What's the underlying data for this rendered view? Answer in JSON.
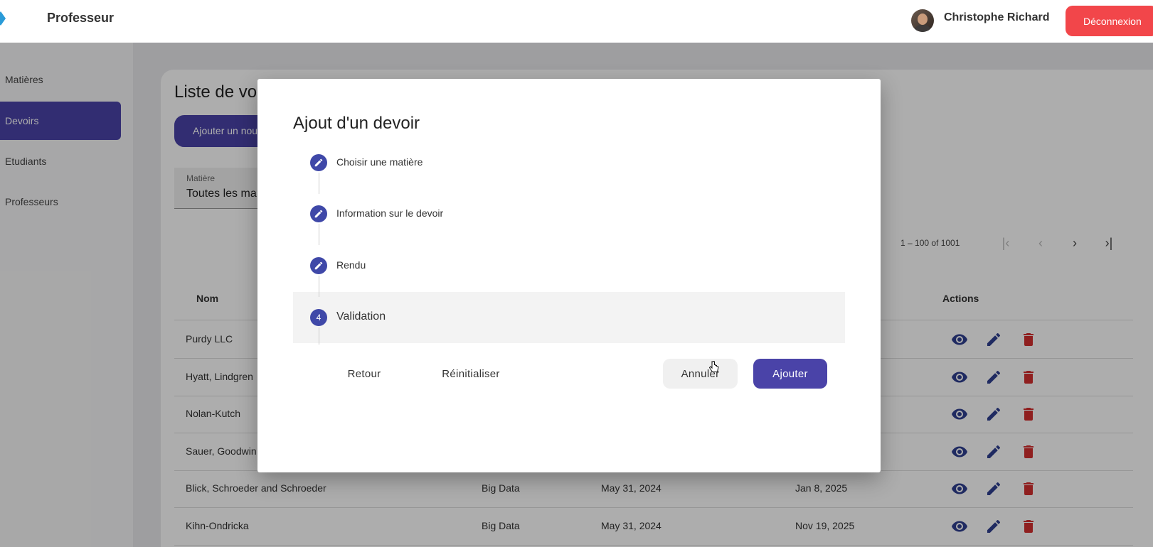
{
  "header": {
    "app_title": "Professeur",
    "user_name": "Christophe Richard",
    "logout_label": "Déconnexion"
  },
  "sidebar": {
    "items": [
      {
        "label": "Matières"
      },
      {
        "label": "Devoirs",
        "active": true
      },
      {
        "label": "Etudiants"
      },
      {
        "label": "Professeurs"
      }
    ]
  },
  "main": {
    "title": "Liste de vo",
    "add_button_label": "Ajouter un nou",
    "filter": {
      "label": "Matière",
      "value": "Toutes les ma"
    },
    "paginator": {
      "range": "1 – 100 of 1001"
    },
    "columns": {
      "name": "Nom",
      "actions": "Actions"
    },
    "rows": [
      {
        "name": "Purdy LLC",
        "subject": "",
        "date1": "",
        "date2": ""
      },
      {
        "name": "Hyatt, Lindgren",
        "subject": "",
        "date1": "",
        "date2": ""
      },
      {
        "name": "Nolan-Kutch",
        "subject": "",
        "date1": "",
        "date2": ""
      },
      {
        "name": "Sauer, Goodwin",
        "subject": "",
        "date1": "",
        "date2": ""
      },
      {
        "name": "Blick, Schroeder and Schroeder",
        "subject": "Big Data",
        "date1": "May 31, 2024",
        "date2": "Jan 8, 2025"
      },
      {
        "name": "Kihn-Ondricka",
        "subject": "Big Data",
        "date1": "May 31, 2024",
        "date2": "Nov 19, 2025"
      }
    ]
  },
  "dialog": {
    "title": "Ajout d'un devoir",
    "steps": [
      {
        "label": "Choisir une matière",
        "icon": "edit-icon"
      },
      {
        "label": "Information sur le devoir",
        "icon": "edit-icon"
      },
      {
        "label": "Rendu",
        "icon": "edit-icon"
      },
      {
        "label": "Validation",
        "number": "4"
      }
    ],
    "buttons": {
      "back": "Retour",
      "reset": "Réinitialiser",
      "cancel": "Annuler",
      "submit": "Ajouter"
    }
  },
  "colors": {
    "primary": "#4a43a8",
    "step": "#3f48a8",
    "danger": "#f2464a",
    "delete_icon": "#d32f2f",
    "view_icon": "#2f3f8f"
  }
}
